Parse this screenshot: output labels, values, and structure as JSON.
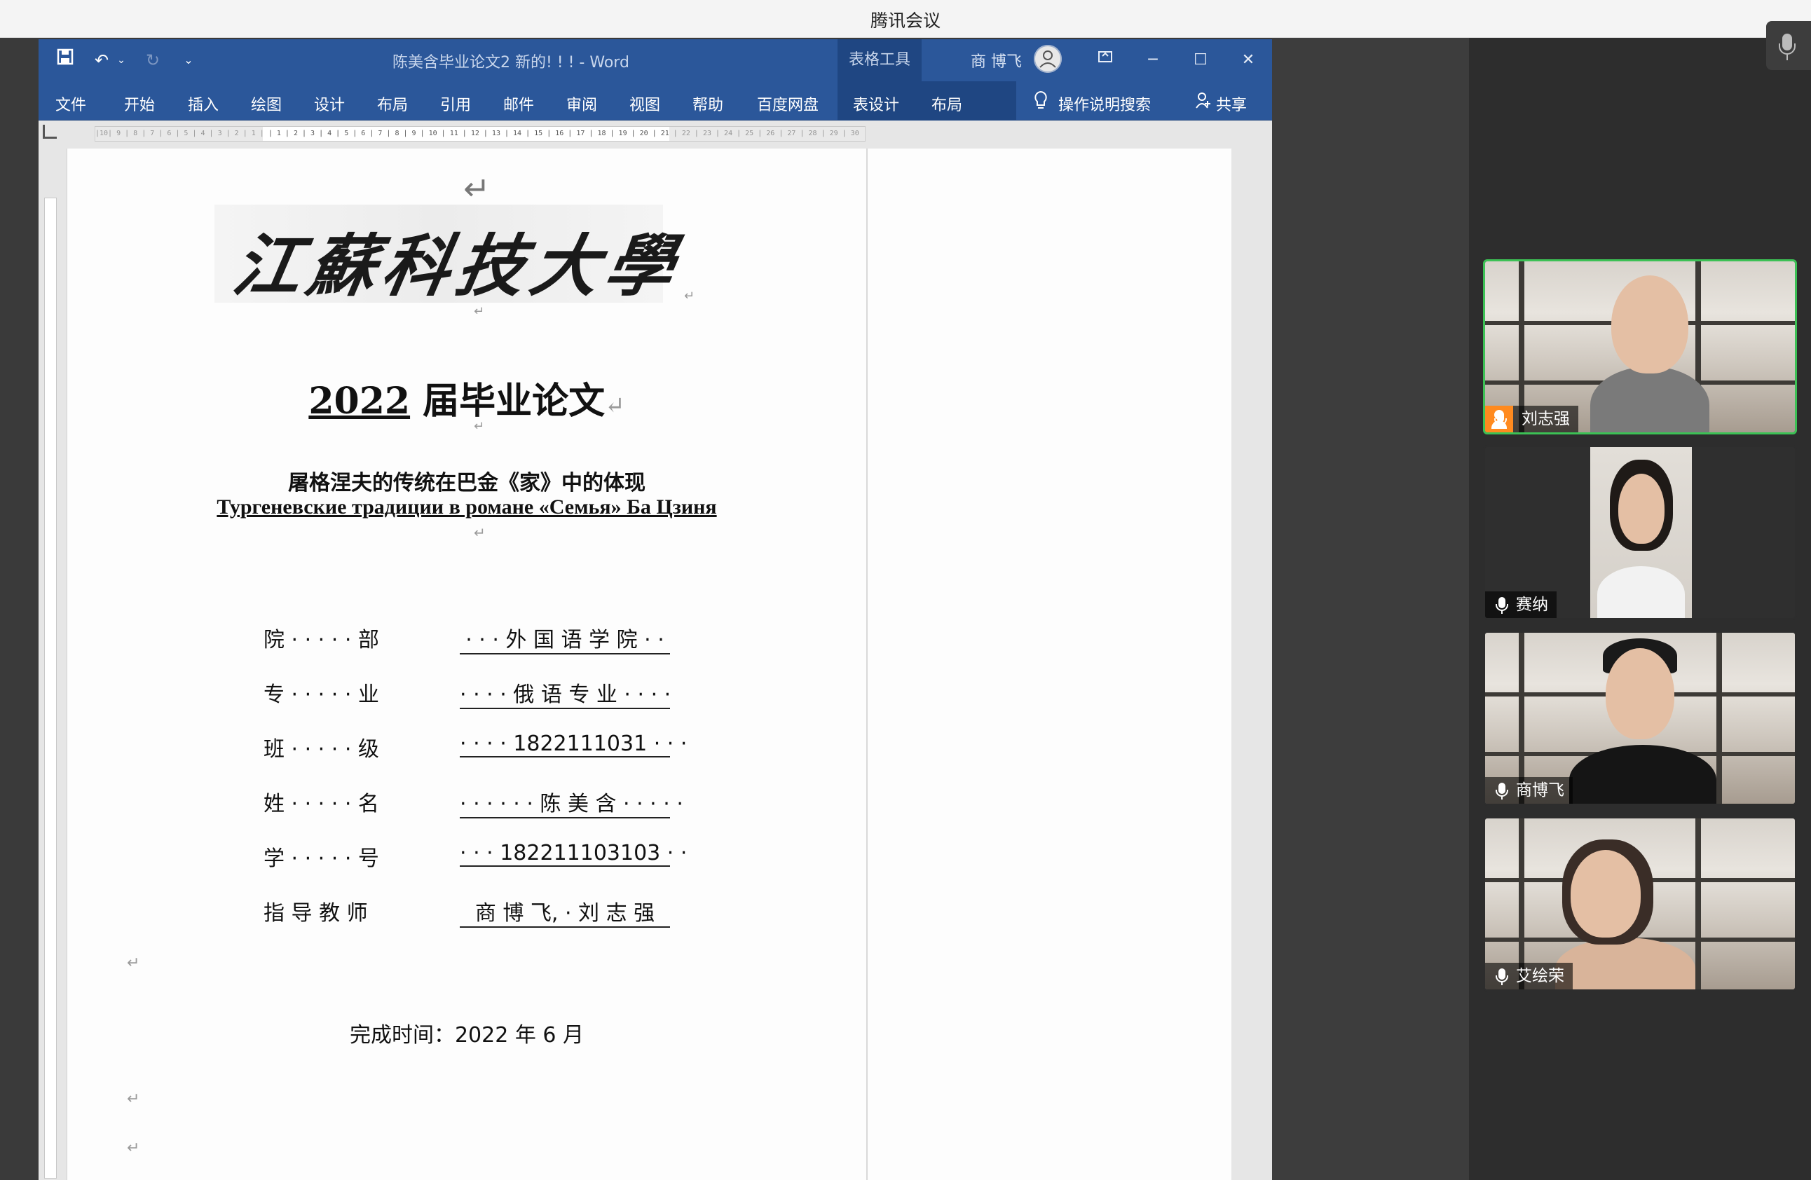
{
  "meeting": {
    "app_title": "腾讯会议"
  },
  "word": {
    "doc_title": "陈美含毕业论文2 新的! ! ! - Word",
    "context_tab": "表格工具",
    "user_name": "商 博飞",
    "ribbon_tabs": [
      "文件",
      "开始",
      "插入",
      "绘图",
      "设计",
      "布局",
      "引用",
      "邮件",
      "审阅",
      "视图",
      "帮助",
      "百度网盘",
      "表设计",
      "布局"
    ],
    "tell_me": "操作说明搜索",
    "share": "共享",
    "ruler_text": "|10| 9 | 8 | 7 | 6 | 5 | 4 | 3 | 2 | 1 |  | 1 | 2 | 3 | 4 | 5 | 6 | 7 | 8 | 9 | 10 | 11 | 12 | 13 | 14 | 15 | 16 | 17 | 18 | 19 | 20 | 21 | 22 | 23 | 24 | 25 | 26 | 27 | 28 | 29 | 30 | 31 | 32 | 33 | 34 | 35 | 36 | 37 | 38 | 39",
    "para_mark": "↵"
  },
  "document": {
    "logo_text": "江蘇科技大學",
    "title_year": "2022",
    "title_main": " 届毕业论文",
    "subtitle_cn": "屠格涅夫的传统在巴金《家》中的体现",
    "subtitle_ru": "Тургеневские традиции в романе «Семья» Ба Цзиня",
    "info_rows": [
      {
        "label": "院 · · · · · 部",
        "value": "· · · 外 国 语 学 院 · ·"
      },
      {
        "label": "专 · · · · · 业",
        "value": "· · · · 俄 语 专 业 · · · ·"
      },
      {
        "label": "班 · · · · · 级",
        "value": "· · · · 1822111031 · · ·"
      },
      {
        "label": "姓 · · · · · 名",
        "value": "· · · · · · 陈 美 含 · · · · ·"
      },
      {
        "label": "学 · · · · · 号",
        "value": "· · · 182211103103 · ·"
      },
      {
        "label": "指 导 教 师",
        "value": "商 博 飞, · 刘 志 强"
      }
    ],
    "completion": "完成时间：2022 年 6 月"
  },
  "participants": [
    {
      "name": "刘志强",
      "host": true,
      "active": true
    },
    {
      "name": "赛纳",
      "host": false,
      "active": false
    },
    {
      "name": "商博飞",
      "host": false,
      "active": false
    },
    {
      "name": "艾绘荣",
      "host": false,
      "active": false
    }
  ]
}
